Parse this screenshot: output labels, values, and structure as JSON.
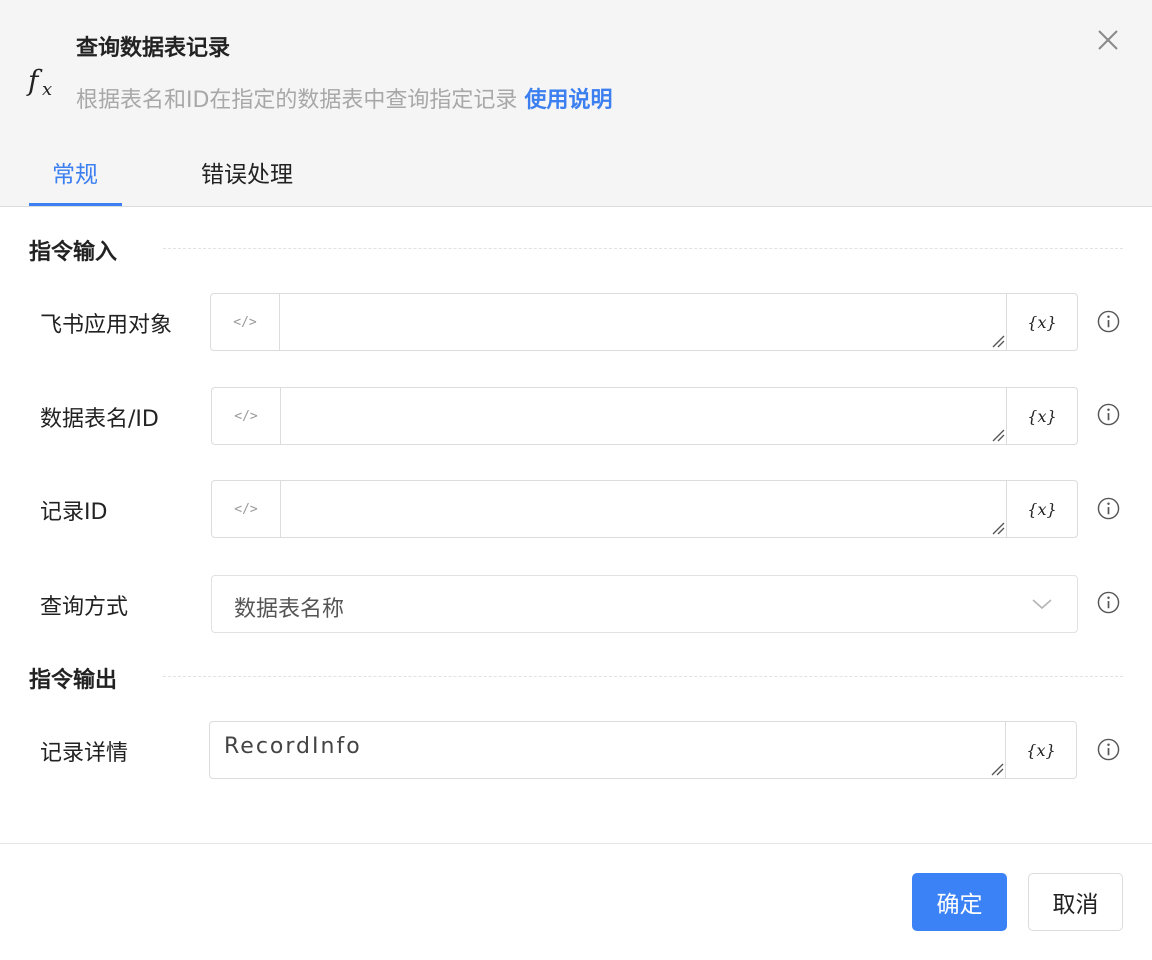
{
  "header": {
    "title": "查询数据表记录",
    "subtitle": "根据表名和ID在指定的数据表中查询指定记录",
    "help_link": "使用说明",
    "icon": "fx-function-icon"
  },
  "tabs": [
    {
      "label": "常规",
      "active": true
    },
    {
      "label": "错误处理",
      "active": false
    }
  ],
  "input_section": {
    "title": "指令输入",
    "fields": [
      {
        "label": "飞书应用对象",
        "value": "",
        "code_label": "</>",
        "var_label": "{x}"
      },
      {
        "label": "数据表名/ID",
        "value": "",
        "code_label": "</>",
        "var_label": "{x}"
      },
      {
        "label": "记录ID",
        "value": "",
        "code_label": "</>",
        "var_label": "{x}"
      }
    ],
    "query_mode": {
      "label": "查询方式",
      "selected": "数据表名称"
    }
  },
  "output_section": {
    "title": "指令输出",
    "fields": [
      {
        "label": "记录详情",
        "value": "RecordInfo",
        "var_label": "{x}"
      }
    ]
  },
  "footer": {
    "ok_label": "确定",
    "cancel_label": "取消"
  },
  "colors": {
    "accent": "#3b7ff0",
    "primary_button": "#3b82f6",
    "header_bg": "#f5f5f5"
  }
}
